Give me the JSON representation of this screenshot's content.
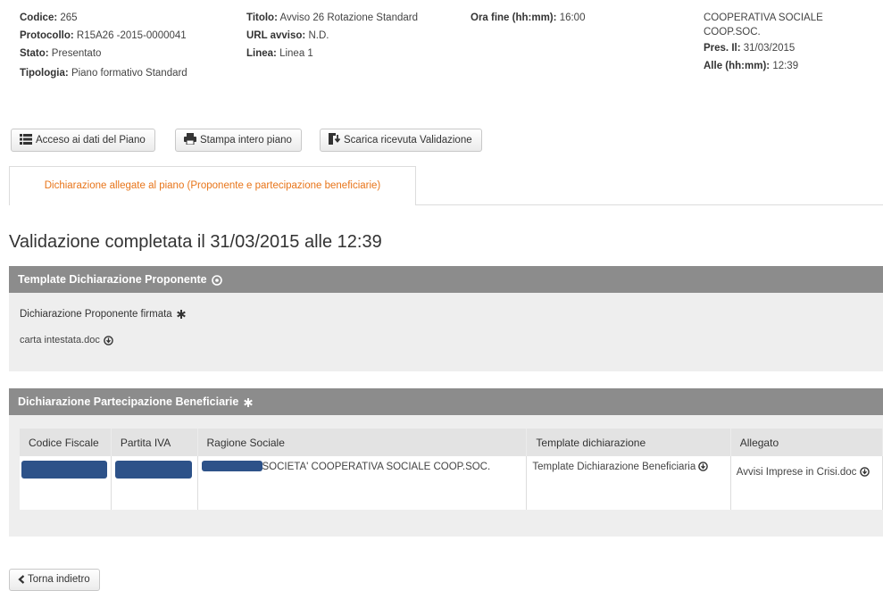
{
  "header": {
    "col1": [
      {
        "label": "Codice:",
        "value": "265"
      },
      {
        "label": "Protocollo:",
        "value": "R15A26 -2015-0000041"
      },
      {
        "label": "Stato:",
        "value": "Presentato"
      },
      {
        "label": "Tipologia:",
        "value": "Piano formativo Standard"
      }
    ],
    "col2": [
      {
        "label": "Titolo:",
        "value": "Avviso 26 Rotazione Standard"
      },
      {
        "label": "URL avviso:",
        "value": "N.D."
      },
      {
        "label": "Linea:",
        "value": "Linea 1"
      }
    ],
    "col3": [
      {
        "label": "Ora fine (hh:mm):",
        "value": "16:00"
      }
    ],
    "col4": {
      "org_line1": "COOPERATIVA SOCIALE",
      "org_line2": "COOP.SOC.",
      "pres_label": "Pres. Il:",
      "pres_value": "31/03/2015",
      "alle_label": "Alle (hh:mm):",
      "alle_value": "12:39"
    }
  },
  "toolbar": {
    "btn_piano": "Acceso ai dati del Piano",
    "btn_stampa": "Stampa intero piano",
    "btn_ricevuta": "Scarica ricevuta Validazione"
  },
  "tab": {
    "label": "Dichiarazione allegate al piano (Proponente e partecipazione beneficiarie)"
  },
  "page_title": "Validazione completata il 31/03/2015 alle 12:39",
  "panel1": {
    "title": "Template Dichiarazione Proponente",
    "field_label": "Dichiarazione Proponente firmata",
    "file": "carta intestata.doc"
  },
  "panel2": {
    "title": "Dichiarazione Partecipazione Beneficiarie",
    "columns": [
      "Codice Fiscale",
      "Partita IVA",
      "Ragione Sociale",
      "Template dichiarazione",
      "Allegato"
    ],
    "row": {
      "ragione_sociale": "SOCIETA' COOPERATIVA SOCIALE COOP.SOC.",
      "template": "Template Dichiarazione Beneficiaria",
      "allegato": "Avvisi Imprese in Crisi.doc"
    }
  },
  "back_button": "Torna indietro",
  "colors": {
    "accent_orange": "#e8751a",
    "panel_header": "#8c8c8c",
    "panel_body": "#eeeeee",
    "redaction": "#2d5289"
  }
}
